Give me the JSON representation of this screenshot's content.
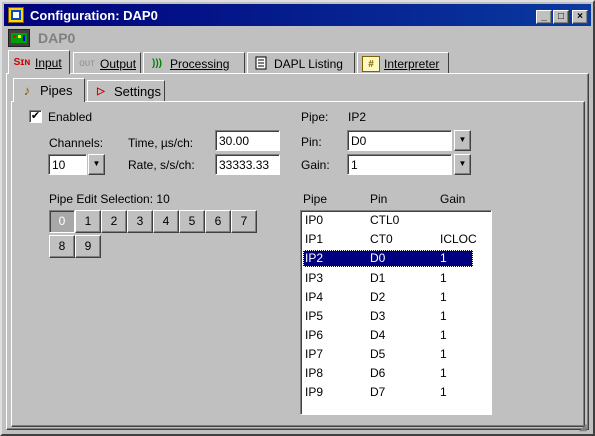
{
  "window": {
    "title": "Configuration:  DAP0",
    "subtitle": "DAP0"
  },
  "title_buttons": {
    "minimize": "_",
    "maximize": "□",
    "close": "×"
  },
  "main_tabs": [
    {
      "label": "Input",
      "icon": "input-icon"
    },
    {
      "label": "Output",
      "icon": "output-icon"
    },
    {
      "label": "Processing",
      "icon": "processing-icon"
    },
    {
      "label": "DAPL Listing",
      "icon": "listing-icon"
    },
    {
      "label": "Interpreter",
      "icon": "interpreter-icon"
    }
  ],
  "sub_tabs": [
    {
      "label": "Pipes",
      "icon": "pipes-icon"
    },
    {
      "label": "Settings",
      "icon": "settings-icon"
    }
  ],
  "pipes": {
    "enabled_label": "Enabled",
    "enabled_checked": true,
    "channels_label": "Channels:",
    "channels_value": "10",
    "time_label": "Time, µs/ch:",
    "time_value": "30.00",
    "rate_label": "Rate, s/s/ch:",
    "rate_value": "33333.33",
    "pipe_label": "Pipe:",
    "pipe_value": "IP2",
    "pin_label": "Pin:",
    "pin_value": "D0",
    "gain_label": "Gain:",
    "gain_value": "1",
    "edit_selection_label": "Pipe Edit Selection:  10",
    "pipe_buttons": [
      "0",
      "1",
      "2",
      "3",
      "4",
      "5",
      "6",
      "7",
      "8",
      "9"
    ],
    "selected_pipe_button": "0"
  },
  "pipe_table": {
    "headers": [
      "Pipe",
      "Pin",
      "Gain"
    ],
    "rows": [
      [
        "IP0",
        "CTL0",
        ""
      ],
      [
        "IP1",
        "CT0",
        "ICLOC"
      ],
      [
        "IP2",
        "D0",
        "1"
      ],
      [
        "IP3",
        "D1",
        "1"
      ],
      [
        "IP4",
        "D2",
        "1"
      ],
      [
        "IP5",
        "D3",
        "1"
      ],
      [
        "IP6",
        "D4",
        "1"
      ],
      [
        "IP7",
        "D5",
        "1"
      ],
      [
        "IP8",
        "D6",
        "1"
      ],
      [
        "IP9",
        "D7",
        "1"
      ]
    ],
    "selected_row": "IP2"
  },
  "colors": {
    "titlebar": "#00007b",
    "selection": "#000080",
    "face": "#c0c0c0"
  }
}
